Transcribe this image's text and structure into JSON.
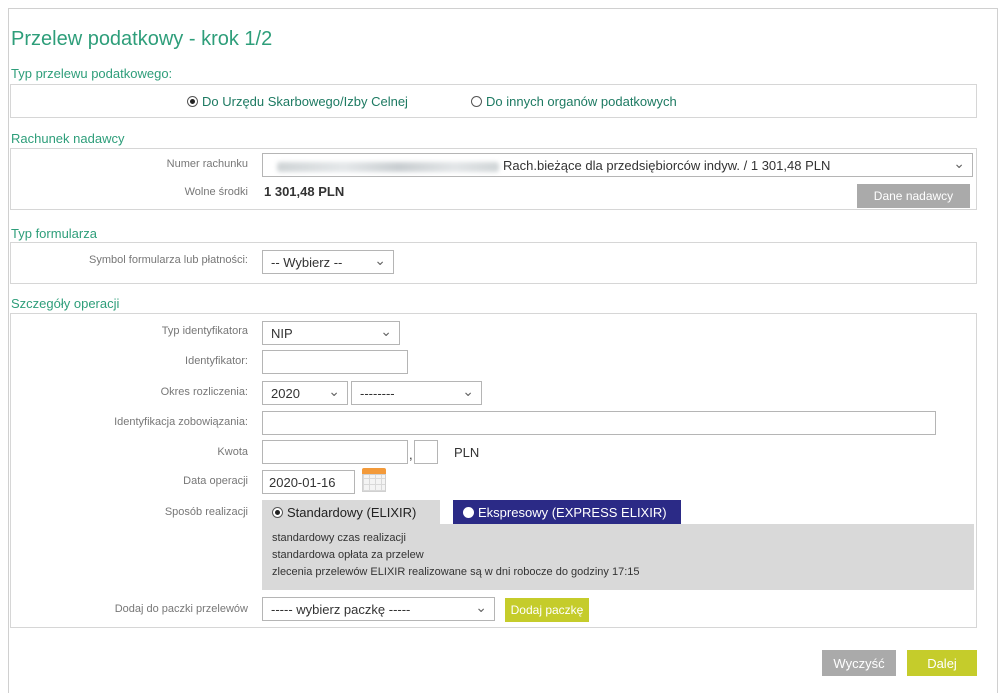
{
  "title": "Przelew podatkowy - krok 1/2",
  "transfer_type": {
    "heading": "Typ przelewu podatkowego:",
    "options": [
      "Do Urzędu Skarbowego/Izby Celnej",
      "Do innych organów podatkowych"
    ],
    "selected": "Do Urzędu Skarbowego/Izby Celnej"
  },
  "sender": {
    "heading": "Rachunek nadawcy",
    "account_label": "Numer rachunku",
    "account_value": "Rach.bieżące dla przedsiębiorców indyw. / 1 301,48 PLN",
    "funds_label": "Wolne środki",
    "funds_value": "1 301,48 PLN",
    "sender_button": "Dane nadawcy"
  },
  "form_type": {
    "heading": "Typ formularza",
    "symbol_label": "Symbol formularza lub płatności:",
    "symbol_value": "-- Wybierz --"
  },
  "details": {
    "heading": "Szczegóły operacji",
    "id_type_label": "Typ identyfikatora",
    "id_type_value": "NIP",
    "identifier_label": "Identyfikator:",
    "identifier_value": "",
    "period_label": "Okres rozliczenia:",
    "period_year": "2020",
    "period_type": "--------",
    "obligation_label": "Identyfikacja zobowiązania:",
    "obligation_value": "",
    "amount_label": "Kwota",
    "amount_whole": "",
    "amount_separator": ",",
    "amount_fraction": "",
    "currency": "PLN",
    "date_label": "Data operacji",
    "date_value": "2020-01-16",
    "mode_label": "Sposób realizacji",
    "mode_standard": "Standardowy (ELIXIR)",
    "mode_express": "Ekspresowy (EXPRESS ELIXIR)",
    "mode_info": [
      "standardowy czas realizacji",
      "standardowa opłata za przelew",
      "zlecenia przelewów ELIXIR realizowane są w dni robocze do godziny 17:15"
    ],
    "package_label": "Dodaj do paczki przelewów",
    "package_value": "----- wybierz paczkę -----",
    "add_package_button": "Dodaj paczkę"
  },
  "actions": {
    "clear": "Wyczyść",
    "next": "Dalej"
  },
  "colors": {
    "accent_green": "#2e9e7a",
    "button_lime": "#c5cc2b",
    "button_gray": "#aaaaaa",
    "express_navy": "#2b2a86"
  }
}
